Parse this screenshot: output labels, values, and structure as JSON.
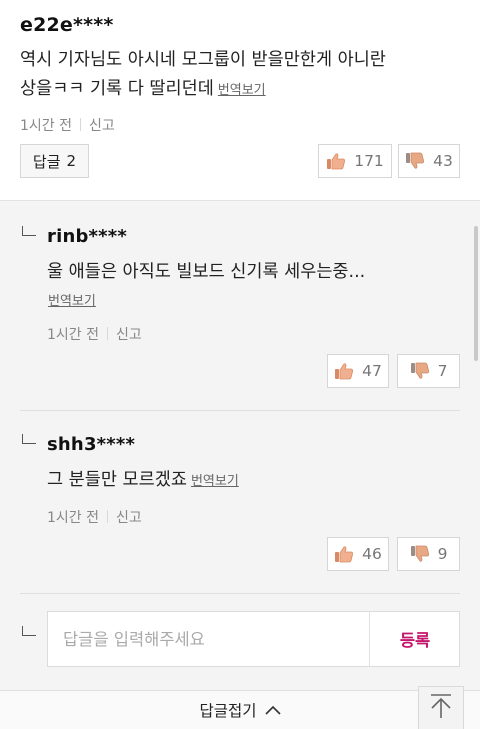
{
  "main": {
    "username": "e22e****",
    "text_line1": "역시 기자님도 아시네 모그룹이 받을만한게 아니란",
    "text_line2": "상을ㅋㅋ 기록 다 딸리던데",
    "translate": "번역보기",
    "time": "1시간 전",
    "report": "신고",
    "reply_label": "답글",
    "reply_count": "2",
    "likes": "171",
    "dislikes": "43"
  },
  "replies": [
    {
      "username": "rinb****",
      "text": "울 애들은 아직도 빌보드 신기록 세우는중...",
      "translate": "번역보기",
      "time": "1시간 전",
      "report": "신고",
      "likes": "47",
      "dislikes": "7"
    },
    {
      "username": "shh3****",
      "text": "그 분들만 모르겠죠",
      "translate": "번역보기",
      "time": "1시간 전",
      "report": "신고",
      "likes": "46",
      "dislikes": "9"
    }
  ],
  "reply_form": {
    "placeholder": "답글을 입력해주세요",
    "submit": "등록"
  },
  "collapse": {
    "label": "답글접기"
  },
  "colors": {
    "accent": "#c5166b",
    "thumb_up": "#e8a07a",
    "thumb_down": "#e8a07a"
  },
  "icons": [
    "reply-indent-icon",
    "thumbs-up-icon",
    "thumbs-down-icon",
    "chevron-up-icon",
    "scroll-top-icon"
  ]
}
